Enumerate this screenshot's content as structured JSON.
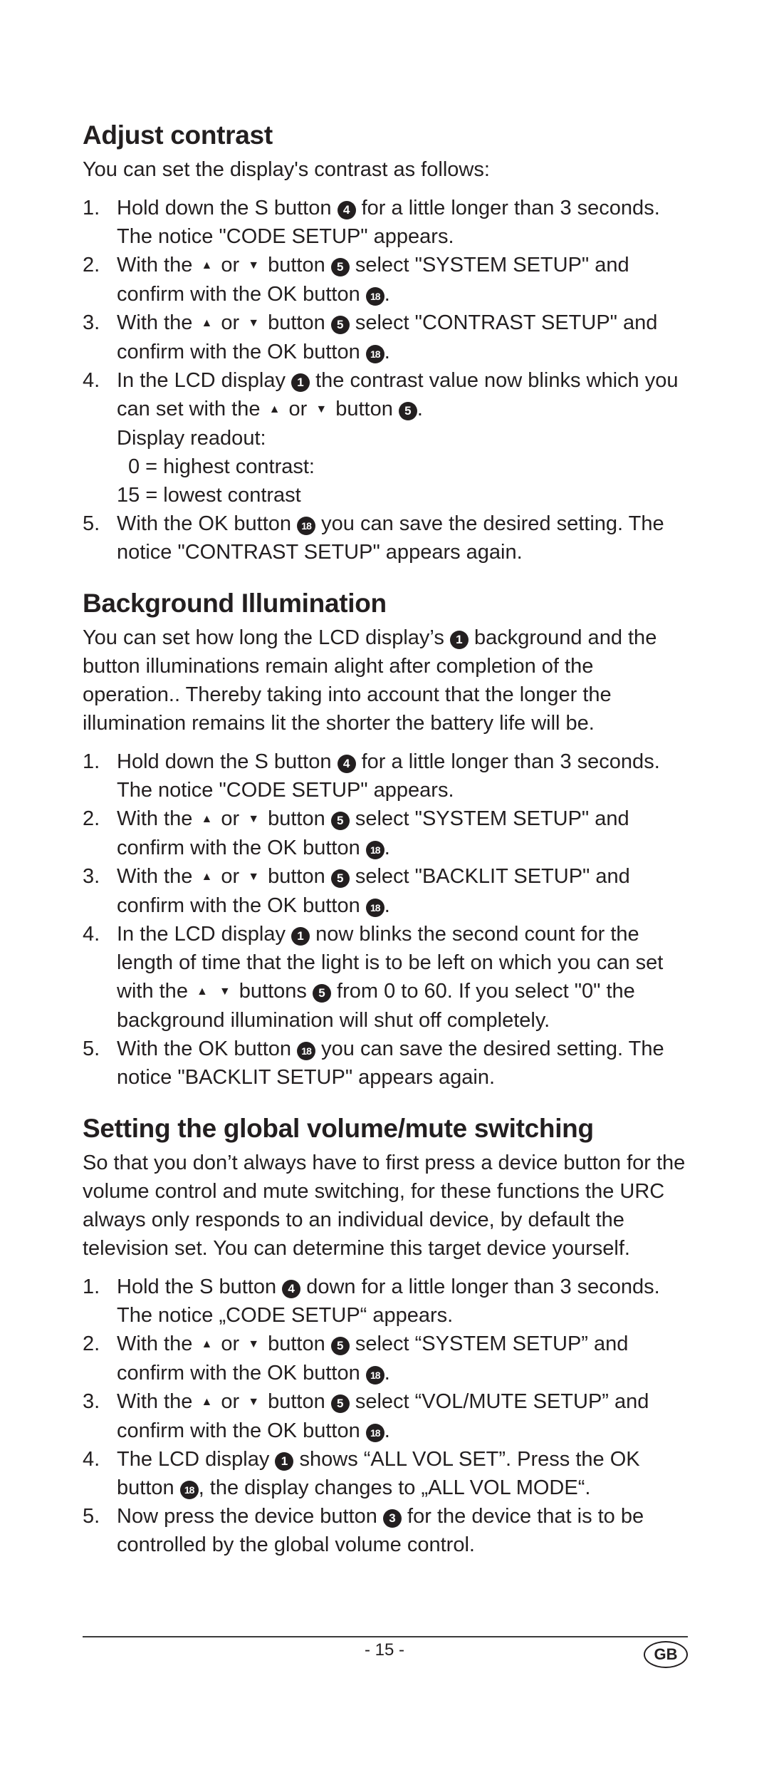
{
  "sections": [
    {
      "title": "Adjust contrast",
      "intro": "You can set the display's contrast as follows:",
      "steps": [
        {
          "n": "1.",
          "parts": [
            "Hold down the S button ",
            {
              "c": "4"
            },
            " for a little longer than 3 seconds. The notice \"CODE SETUP\" appears."
          ]
        },
        {
          "n": "2.",
          "parts": [
            "With the ",
            {
              "t": "up"
            },
            " or ",
            {
              "t": "down"
            },
            " button ",
            {
              "c": "5"
            },
            " select \"SYSTEM SETUP\" and confirm with the OK button ",
            {
              "c": "18"
            },
            "."
          ]
        },
        {
          "n": "3.",
          "parts": [
            "With the ",
            {
              "t": "up"
            },
            " or ",
            {
              "t": "down"
            },
            " button ",
            {
              "c": "5"
            },
            " select \"CONTRAST SETUP\" and confirm with the OK button ",
            {
              "c": "18"
            },
            "."
          ]
        },
        {
          "n": "4.",
          "parts": [
            "In the LCD display ",
            {
              "c": "1"
            },
            " the contrast value now blinks which you can set with the ",
            {
              "t": "up"
            },
            " or ",
            {
              "t": "down"
            },
            " button ",
            {
              "c": "5"
            },
            "."
          ],
          "extra": [
            "Display readout:",
            " 0 = highest contrast:",
            "15 = lowest contrast"
          ]
        },
        {
          "n": "5.",
          "parts": [
            "With the OK button ",
            {
              "c": "18"
            },
            " you can save the desired setting. The notice \"CONTRAST SETUP\" appears again."
          ]
        }
      ]
    },
    {
      "title": "Background Illumination",
      "intro_parts": [
        "You can set how long the LCD display’s ",
        {
          "c": "1"
        },
        " background and the button illuminations remain alight after completion of the operation.. Thereby taking into account that the longer the illumination remains lit the shorter the battery life will be."
      ],
      "steps": [
        {
          "n": "1.",
          "parts": [
            "Hold down the S button ",
            {
              "c": "4"
            },
            " for a little longer than 3 seconds. The notice \"CODE SETUP\" appears."
          ]
        },
        {
          "n": "2.",
          "parts": [
            "With the ",
            {
              "t": "up"
            },
            " or ",
            {
              "t": "down"
            },
            " button ",
            {
              "c": "5"
            },
            " select \"SYSTEM SETUP\" and confirm with the OK button ",
            {
              "c": "18"
            },
            "."
          ]
        },
        {
          "n": "3.",
          "parts": [
            "With the ",
            {
              "t": "up"
            },
            " or ",
            {
              "t": "down"
            },
            " button ",
            {
              "c": "5"
            },
            " select \"BACKLIT SETUP\" and confirm with the OK button ",
            {
              "c": "18"
            },
            "."
          ]
        },
        {
          "n": "4.",
          "parts": [
            "In the LCD display ",
            {
              "c": "1"
            },
            " now blinks the second count for the length of time that the light is to be left on which you can set with the ",
            {
              "t": "up"
            },
            " ",
            {
              "t": "down"
            },
            " buttons ",
            {
              "c": "5"
            },
            " from 0 to 60. If you select \"0\" the background illumination will shut off completely."
          ]
        },
        {
          "n": "5.",
          "parts": [
            "With the OK button ",
            {
              "c": "18"
            },
            " you can save the desired setting. The notice \"BACKLIT SETUP\" appears again."
          ]
        }
      ]
    },
    {
      "title": "Setting the global volume/mute switching",
      "intro": "So that you don’t always have to first press a device button for the volume control and mute switching, for these functions the URC always only responds to an individual device, by default the television set. You can determine this target device yourself.",
      "steps": [
        {
          "n": "1.",
          "parts": [
            "Hold the S button ",
            {
              "c": "4"
            },
            " down for a little longer than 3 seconds. The notice „CODE SETUP“ appears."
          ]
        },
        {
          "n": "2.",
          "parts": [
            "With the ",
            {
              "t": "up"
            },
            " or ",
            {
              "t": "down"
            },
            " button ",
            {
              "c": "5"
            },
            " select “SYSTEM SETUP” and confirm with the OK button ",
            {
              "c": "18"
            },
            "."
          ]
        },
        {
          "n": "3.",
          "parts": [
            "With the ",
            {
              "t": "up"
            },
            " or ",
            {
              "t": "down"
            },
            " button ",
            {
              "c": "5"
            },
            " select “VOL/MUTE SETUP” and confirm with the OK button ",
            {
              "c": "18"
            },
            "."
          ]
        },
        {
          "n": "4.",
          "parts": [
            "The LCD display ",
            {
              "c": "1"
            },
            " shows “ALL VOL SET”. Press the OK button ",
            {
              "c": "18"
            },
            ", the display changes to „ALL VOL MODE“."
          ]
        },
        {
          "n": "5.",
          "parts": [
            "Now press the device button ",
            {
              "c": "3"
            },
            " for the device that is to be controlled by the global volume control."
          ]
        }
      ]
    }
  ],
  "footer": {
    "page_number": "- 15 -",
    "language_badge": "GB"
  }
}
